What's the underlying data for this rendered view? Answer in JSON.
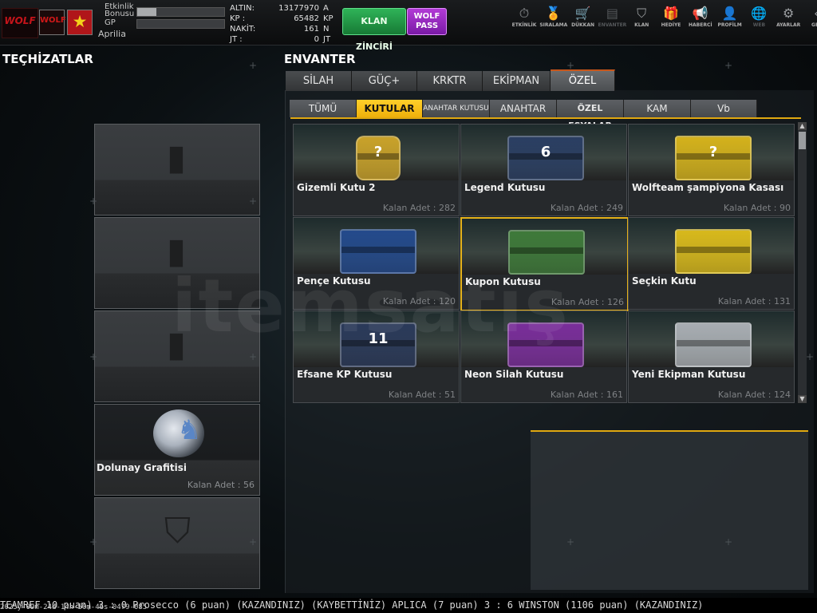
{
  "header": {
    "logo_text": "WOLF",
    "clan_logo_text": "WOLF",
    "labels": {
      "etkinlik": "Etkinlik",
      "bonus": "Bonusu",
      "gp": "GP",
      "player": "Aprilia"
    },
    "progress": {
      "etkinlik": 0.22,
      "gp": 0.0
    },
    "currency": [
      {
        "label": "ALTIN:",
        "value": "13177970",
        "unit": "A"
      },
      {
        "label": "KP :",
        "value": "65482",
        "unit": "KP"
      },
      {
        "label": "NAKİT:",
        "value": "161",
        "unit": "N"
      },
      {
        "label": "JT :",
        "value": "0",
        "unit": "JT"
      }
    ],
    "klan_button": "KLAN ZİNCİRİ",
    "wolf_button_1": "WOLF",
    "wolf_button_2": "PASS",
    "menu": [
      {
        "label": "ETKİNLİK",
        "icon": "stopwatch-icon",
        "glyph": "⏱"
      },
      {
        "label": "SIRALAMA",
        "icon": "medal-icon",
        "glyph": "🏅"
      },
      {
        "label": "DÜKKAN",
        "icon": "cart-icon",
        "glyph": "🛒"
      },
      {
        "label": "ENVANTER",
        "icon": "inventory-icon",
        "glyph": "▤"
      },
      {
        "label": "KLAN",
        "icon": "shield-icon",
        "glyph": "⛉"
      },
      {
        "label": "HEDİYE",
        "icon": "gift-icon",
        "glyph": "🎁"
      },
      {
        "label": "HABERCİ",
        "icon": "megaphone-icon",
        "glyph": "📢"
      },
      {
        "label": "PROFİLM",
        "icon": "profile-icon",
        "glyph": "👤"
      },
      {
        "label": "WEB",
        "icon": "globe-icon",
        "glyph": "🌐"
      },
      {
        "label": "AYARLAR",
        "icon": "gear-icon",
        "glyph": "⚙"
      },
      {
        "label": "GERİ",
        "icon": "back-icon",
        "glyph": "«"
      }
    ]
  },
  "equipment": {
    "title": "TEÇHİZATLAR",
    "slots": [
      {
        "name": "",
        "count": ""
      },
      {
        "name": "",
        "count": ""
      },
      {
        "name": "",
        "count": ""
      },
      {
        "name": "Dolunay Grafitisi",
        "count": "Kalan Adet : 56"
      },
      {
        "name": "",
        "count": ""
      }
    ]
  },
  "inventory": {
    "title": "ENVANTER",
    "tabs": [
      "SİLAH",
      "GÜÇ+",
      "KRKTR",
      "EKİPMAN",
      "ÖZEL"
    ],
    "subtabs": [
      "TÜMÜ",
      "KUTULAR",
      "ANAHTAR KUTUSU",
      "ANAHTAR",
      "ÖZEL EŞYALAR",
      "KAM",
      "Vb"
    ],
    "items": [
      {
        "name": "Gizemli Kutu 2",
        "count": "Kalan Adet : 282",
        "color": "#c9a22a",
        "label": "?"
      },
      {
        "name": "Legend Kutusu",
        "count": "Kalan Adet : 249",
        "color": "#2b3f63",
        "label": "6"
      },
      {
        "name": "Wolfteam şampiyona Kasası",
        "count": "Kalan Adet : 90",
        "color": "#d4b21c",
        "label": "?"
      },
      {
        "name": "Pençe Kutusu",
        "count": "Kalan Adet : 120",
        "color": "#244a8c",
        "label": ""
      },
      {
        "name": "Kupon Kutusu",
        "count": "Kalan Adet : 126",
        "color": "#3f7a3a",
        "label": ""
      },
      {
        "name": "Seçkin Kutu",
        "count": "Kalan Adet : 131",
        "color": "#d8b91c",
        "label": ""
      },
      {
        "name": "Efsane KP Kutusu",
        "count": "Kalan Adet : 51",
        "color": "#2b3a5a",
        "label": "11"
      },
      {
        "name": "Neon Silah Kutusu",
        "count": "Kalan Adet : 161",
        "color": "#7a2e9a",
        "label": ""
      },
      {
        "name": "Yeni Ekipman Kutusu",
        "count": "Kalan Adet : 124",
        "color": "#a8adb2",
        "label": ""
      }
    ]
  },
  "ticker": "TEAMREF 10 puan) 3 : 0 Prosecco (6 puan) (KAZANDINIZ)        (KAYBETTİNİZ) APLICA (7 puan) 3 : 6 WINSTON (1106 puan) (KAZANDINIZ)",
  "timestamp": "2025y-09m-24d-14h-50m-46s-0479-085",
  "watermark": "itemsatış"
}
